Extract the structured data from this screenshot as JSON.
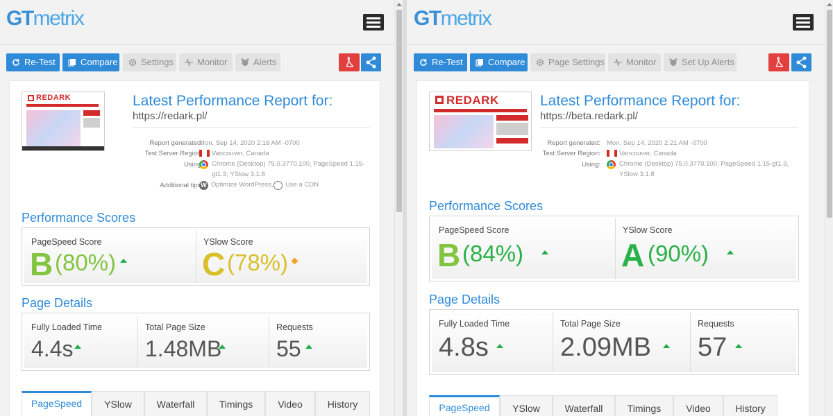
{
  "app": {
    "logo_gt": "GT",
    "logo_metrix": "metrix"
  },
  "left": {
    "toolbar": {
      "retest": "Re-Test",
      "compare": "Compare",
      "settings": "Settings",
      "monitor": "Monitor",
      "alerts": "Alerts"
    },
    "report": {
      "title": "Latest Performance Report for:",
      "url": "https://redark.pl/",
      "generated_label": "Report generated:",
      "generated_value": "Mon, Sep 14, 2020 2:16 AM -0700",
      "region_label": "Test Server Region:",
      "region_value": "Vancouver, Canada",
      "using_label": "Using:",
      "using_value": "Chrome (Desktop) 75.0.3770.100, PageSpeed 1.15-gt1.3, YSlow 3.1.8",
      "tips_label": "Additional tips:",
      "tip1": "Optimize WordPress,",
      "tip2": "Use a CDN"
    },
    "scores": {
      "title": "Performance Scores",
      "pagespeed_label": "PageSpeed Score",
      "pagespeed_grade": "B",
      "pagespeed_pct": "(80%)",
      "yslow_label": "YSlow Score",
      "yslow_grade": "C",
      "yslow_pct": "(78%)"
    },
    "details": {
      "title": "Page Details",
      "loaded_label": "Fully Loaded Time",
      "loaded_value": "4.4s",
      "size_label": "Total Page Size",
      "size_value": "1.48MB",
      "requests_label": "Requests",
      "requests_value": "55"
    }
  },
  "right": {
    "toolbar": {
      "retest": "Re-Test",
      "compare": "Compare",
      "settings": "Page Settings",
      "monitor": "Monitor",
      "alerts": "Set Up Alerts"
    },
    "report": {
      "title": "Latest Performance Report for:",
      "url": "https://beta.redark.pl/",
      "generated_label": "Report generated:",
      "generated_value": "Mon, Sep 14, 2020 2:21 AM -0700",
      "region_label": "Test Server Region:",
      "region_value": "Vancouver, Canada",
      "using_label": "Using:",
      "using_value": "Chrome (Desktop) 75.0.3770.100, PageSpeed 1.15-gt1.3, YSlow 3.1.8"
    },
    "scores": {
      "title": "Performance Scores",
      "pagespeed_label": "PageSpeed Score",
      "pagespeed_grade": "B",
      "pagespeed_pct": "(84%)",
      "yslow_label": "YSlow Score",
      "yslow_grade": "A",
      "yslow_pct": "(90%)"
    },
    "details": {
      "title": "Page Details",
      "loaded_label": "Fully Loaded Time",
      "loaded_value": "4.8s",
      "size_label": "Total Page Size",
      "size_value": "2.09MB",
      "requests_label": "Requests",
      "requests_value": "57"
    }
  },
  "thumbnail": {
    "brand": "REDARK"
  },
  "tabs": [
    "PageSpeed",
    "YSlow",
    "Waterfall",
    "Timings",
    "Video",
    "History"
  ],
  "colors": {
    "accent": "#2f8ad8",
    "grade_a": "#29b247",
    "grade_b": "#83c441",
    "grade_c": "#d9c02a",
    "pdf_red": "#e2403f",
    "trend_up": "#1fae4b",
    "trend_neutral": "#f2a22b"
  }
}
